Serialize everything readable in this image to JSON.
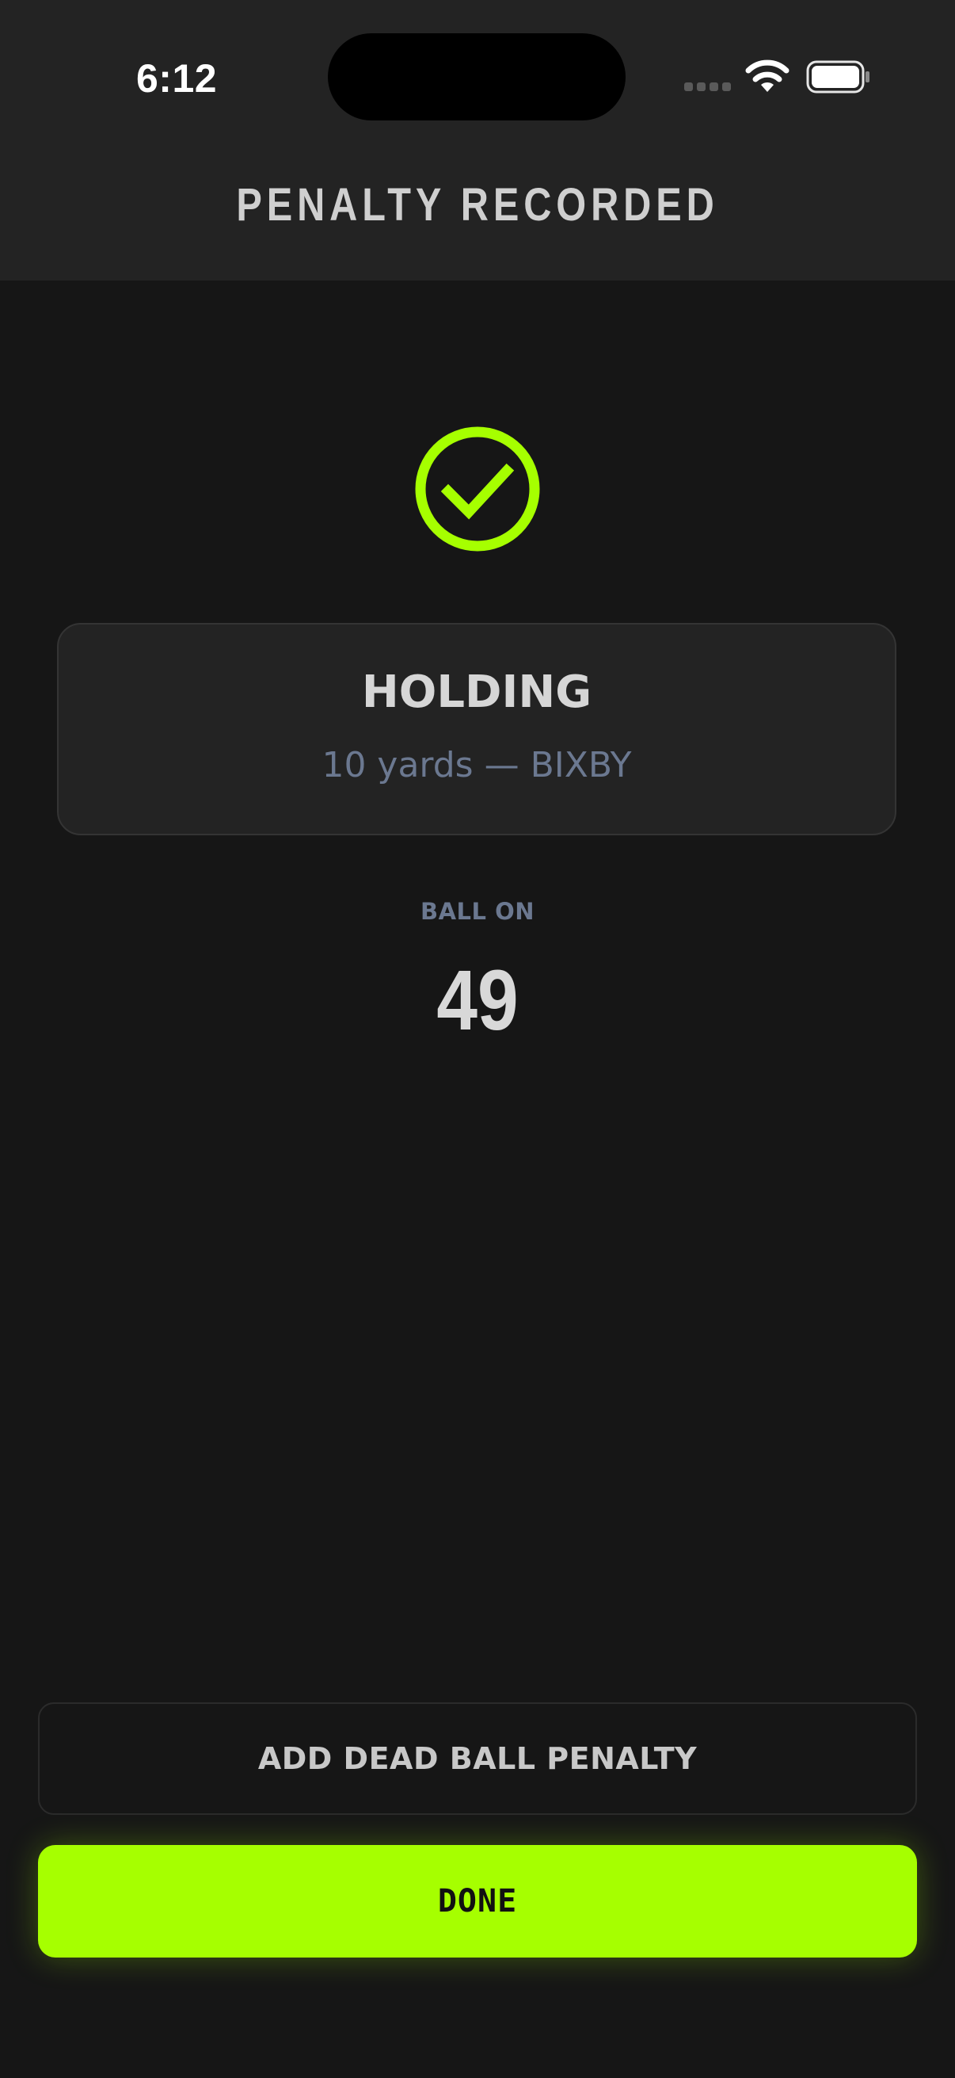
{
  "status_bar": {
    "time": "6:12",
    "signal_icon": "signal-dots-icon",
    "wifi_icon": "wifi-icon",
    "battery_icon": "battery-icon"
  },
  "header": {
    "title": "PENALTY RECORDED"
  },
  "confirmation": {
    "icon": "check-circle-icon",
    "accent_color": "#a6ff00"
  },
  "penalty_card": {
    "name": "HOLDING",
    "detail": "10 yards — BIXBY"
  },
  "ball_position": {
    "label": "BALL ON",
    "value": "49"
  },
  "actions": {
    "secondary_label": "ADD DEAD BALL PENALTY",
    "primary_label": "DONE"
  }
}
